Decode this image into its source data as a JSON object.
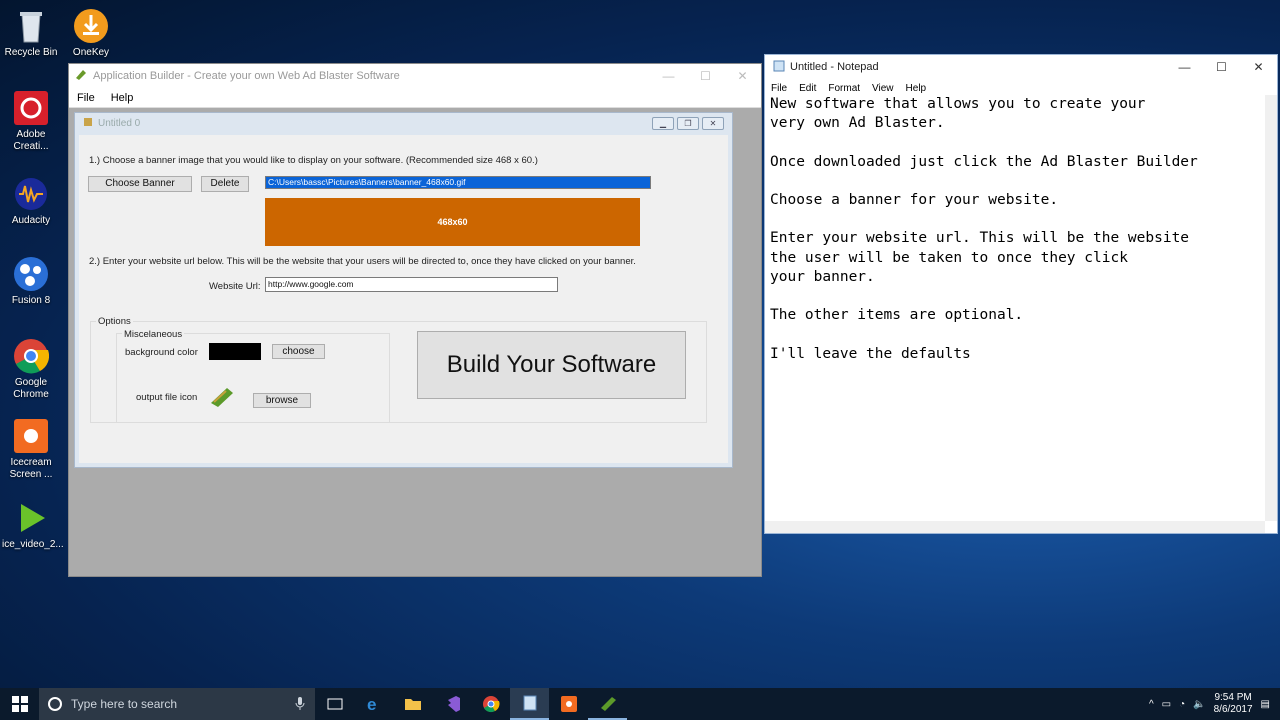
{
  "desktop_icons": [
    {
      "label": "Recycle Bin",
      "icon": "recycle-bin-icon"
    },
    {
      "label": "OneKey",
      "icon": "onekey-icon"
    },
    {
      "label": "Adobe Creati...",
      "icon": "adobe-cc-icon"
    },
    {
      "label": "Audacity",
      "icon": "audacity-icon"
    },
    {
      "label": "Fusion 8",
      "icon": "fusion-icon"
    },
    {
      "label": "Google Chrome",
      "icon": "chrome-icon"
    },
    {
      "label": "Icecream Screen ...",
      "icon": "icecream-icon"
    },
    {
      "label": "ice_video_2...",
      "icon": "video-file-icon"
    }
  ],
  "app": {
    "title": "Application Builder - Create your own Web Ad Blaster Software",
    "menu": [
      "File",
      "Help"
    ],
    "child_title": "Untitled 0",
    "step1": "1.) Choose a banner image that you would like to display on your software. (Recommended size 468 x 60.)",
    "choose_banner": "Choose Banner",
    "delete": "Delete",
    "banner_path": "C:\\Users\\bassc\\Pictures\\Banners\\banner_468x60.gif",
    "banner_text": "468x60",
    "banner_color": "#cc6600",
    "step2": "2.) Enter your website url below. This will be the website that your users will be directed to, once they have clicked on your banner.",
    "website_label": "Website Url:",
    "website_value": "http://www.google.com",
    "options_label": "Options",
    "misc_label": "Miscelaneous",
    "bg_color_label": "background color",
    "choose": "choose",
    "output_icon_label": "output file icon",
    "browse": "browse",
    "build": "Build Your Software"
  },
  "notepad": {
    "title": "Untitled - Notepad",
    "menu": [
      "File",
      "Edit",
      "Format",
      "View",
      "Help"
    ],
    "content": "New software that allows you to create your\nvery own Ad Blaster.\n\nOnce downloaded just click the Ad Blaster Builder\n\nChoose a banner for your website.\n\nEnter your website url. This will be the website\nthe user will be taken to once they click\nyour banner.\n\nThe other items are optional.\n\nI'll leave the defaults "
  },
  "taskbar": {
    "search_placeholder": "Type here to search",
    "time": "9:54 PM",
    "date": "8/6/2017"
  }
}
